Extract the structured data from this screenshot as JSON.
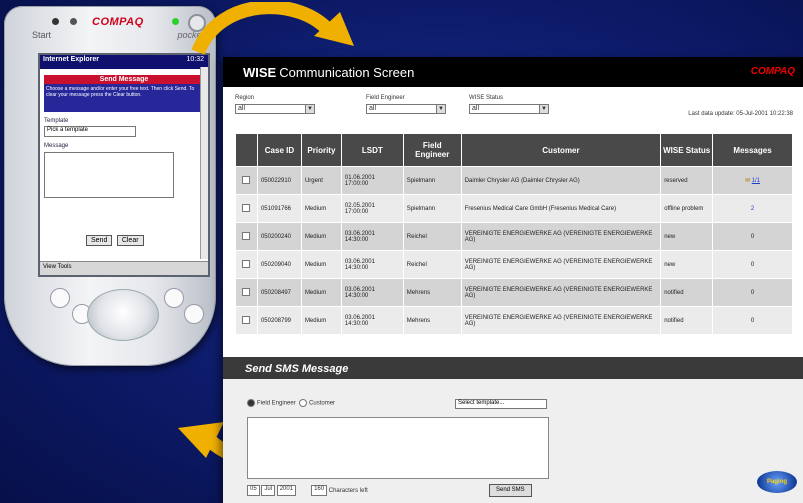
{
  "pda": {
    "brand": "COMPAQ",
    "start_label": "Start",
    "pocket_label": "pocket",
    "browser_title": "Internet Explorer",
    "browser_time": "10:32",
    "panel_title": "Send Message",
    "panel_text": "Choose a message and/or enter your free text. Then click Send. To clear your message press the Clear button.",
    "template_label": "Template",
    "template_value": "Pick a template",
    "message_label": "Message",
    "send_label": "Send",
    "clear_label": "Clear",
    "taskbar_label": "View Tools"
  },
  "wise": {
    "title_bold": "WISE",
    "title_rest": "Communication Screen",
    "logo": "COMPAQ",
    "filters": [
      {
        "label": "Region",
        "value": "all"
      },
      {
        "label": "Field Engineer",
        "value": "all"
      },
      {
        "label": "WISE Status",
        "value": "all"
      }
    ],
    "last_update": "Last data update: 05-Jul-2001 10:22:38",
    "columns": [
      "",
      "Case ID",
      "Priority",
      "LSDT",
      "Field Engineer",
      "Customer",
      "WISE Status",
      "Messages"
    ],
    "rows": [
      {
        "case_id": "050022910",
        "priority": "Urgent",
        "lsdt": "01.06.2001 17:00:00",
        "engineer": "Spielmann",
        "customer": "Daimler Chrysler AG (Daimler Chrysler AG)",
        "status": "reserved",
        "messages": "1/1"
      },
      {
        "case_id": "051091766",
        "priority": "Medium",
        "lsdt": "02.05.2001 17:00:00",
        "engineer": "Spielmann",
        "customer": "Fresenius Medical Care GmbH (Fresenius Medical Care)",
        "status": "offline problem",
        "messages": "2"
      },
      {
        "case_id": "050200240",
        "priority": "Medium",
        "lsdt": "03.06.2001 14:30:00",
        "engineer": "Reichel",
        "customer": "VEREINIGTE ENERGIEWERKE AG (VEREINIGTE ENERGIEWERKE AG)",
        "status": "new",
        "messages": "0"
      },
      {
        "case_id": "050209040",
        "priority": "Medium",
        "lsdt": "03.06.2001 14:30:00",
        "engineer": "Reichel",
        "customer": "VEREINIGTE ENERGIEWERKE AG (VEREINIGTE ENERGIEWERKE AG)",
        "status": "new",
        "messages": "0"
      },
      {
        "case_id": "050208497",
        "priority": "Medium",
        "lsdt": "03.06.2001 14:30:00",
        "engineer": "Mehrens",
        "customer": "VEREINIGTE ENERGIEWERKE AG (VEREINIGTE ENERGIEWERKE AG)",
        "status": "notified",
        "messages": "0"
      },
      {
        "case_id": "050208799",
        "priority": "Medium",
        "lsdt": "03.06.2001 14:30:00",
        "engineer": "Mehrens",
        "customer": "VEREINIGTE ENERGIEWERKE AG (VEREINIGTE ENERGIEWERKE AG)",
        "status": "notified",
        "messages": "0"
      }
    ],
    "sms": {
      "title": "Send SMS Message",
      "radio_field": "Field Engineer",
      "radio_customer": "Customer",
      "recipient_select": "Select template...",
      "day": "05",
      "month": "Jul",
      "year": "2001",
      "count": "160",
      "chars_label": "Characters left",
      "send_button": "Send SMS"
    },
    "partner_logo": "Paging"
  }
}
